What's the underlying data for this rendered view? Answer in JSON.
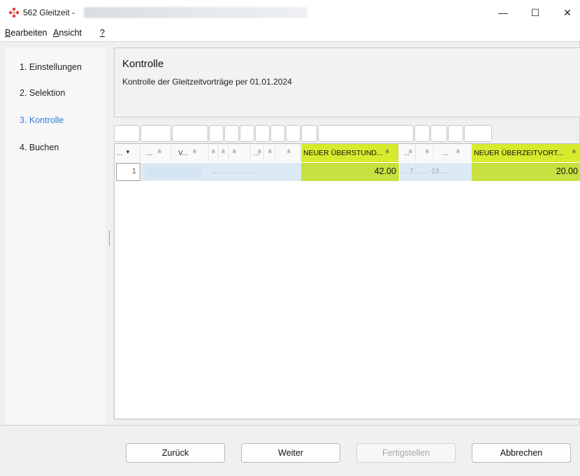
{
  "window": {
    "title": "562 Gleitzeit -",
    "min_glyph": "—",
    "max_glyph": "☐",
    "close_glyph": "✕"
  },
  "menu": {
    "items": [
      {
        "mnemonic": "B",
        "rest": "earbeiten"
      },
      {
        "mnemonic": "A",
        "rest": "nsicht"
      },
      {
        "mnemonic": "?",
        "rest": ""
      }
    ]
  },
  "steps": [
    {
      "label": "1. Einstellungen",
      "active": false
    },
    {
      "label": "2. Selektion",
      "active": false
    },
    {
      "label": "3. Kontrolle",
      "active": true
    },
    {
      "label": "4. Buchen",
      "active": false
    }
  ],
  "header": {
    "title": "Kontrolle",
    "subtitle": "Kontrolle der Gleitzeitvorträge per 01.01.2024"
  },
  "grid": {
    "columns": [
      {
        "label": "...",
        "arrow": "▼"
      },
      {
        "label": "...",
        "arrow": "≙"
      },
      {
        "label": "V...",
        "arrow": "≙"
      },
      {
        "label": "",
        "arrow": "≙"
      },
      {
        "label": "",
        "arrow": "≙"
      },
      {
        "label": "",
        "arrow": "≙"
      },
      {
        "label": "...",
        "arrow": "≙"
      },
      {
        "label": "",
        "arrow": "≙"
      },
      {
        "label": "",
        "arrow": "≙"
      },
      {
        "label": "NEUER ÜBERSTUND...",
        "arrow": "≙"
      },
      {
        "label": "...",
        "arrow": "≙"
      },
      {
        "label": "",
        "arrow": "≙"
      },
      {
        "label": "...",
        "arrow": "≙"
      },
      {
        "label": "NEUER ÜBERZEITVORT...",
        "arrow": "≙"
      }
    ],
    "row": {
      "number": "1",
      "faint_a": "...  ...  ...  ...  ...  ...",
      "overtime_new": "42.00",
      "faint_b": "...  7...     ...  -13....",
      "carryover_new": "20.00"
    }
  },
  "buttons": {
    "back": "Zurück",
    "next": "Weiter",
    "finish": "Fertigstellen",
    "cancel": "Abbrechen"
  },
  "colors": {
    "active_step": "#2f7fd1",
    "highlight_column": "#d7ea2e",
    "highlight_cell": "#c8e040",
    "selection_band": "#dceaf6"
  }
}
